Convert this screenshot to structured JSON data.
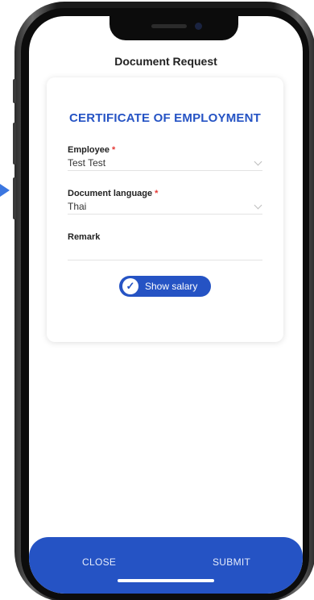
{
  "header": {
    "title": "Document Request"
  },
  "card": {
    "title": "CERTIFICATE OF EMPLOYMENT",
    "fields": [
      {
        "label": "Employee",
        "required_mark": "*",
        "value": "Test Test",
        "has_dropdown": true
      },
      {
        "label": "Document language",
        "required_mark": "*",
        "value": "Thai",
        "has_dropdown": true
      },
      {
        "label": "Remark",
        "value": ""
      }
    ],
    "toggle": {
      "label": "Show salary",
      "checked": true
    }
  },
  "footer": {
    "close_label": "CLOSE",
    "submit_label": "SUBMIT"
  },
  "colors": {
    "accent": "#2553c4",
    "required": "#e53935"
  }
}
